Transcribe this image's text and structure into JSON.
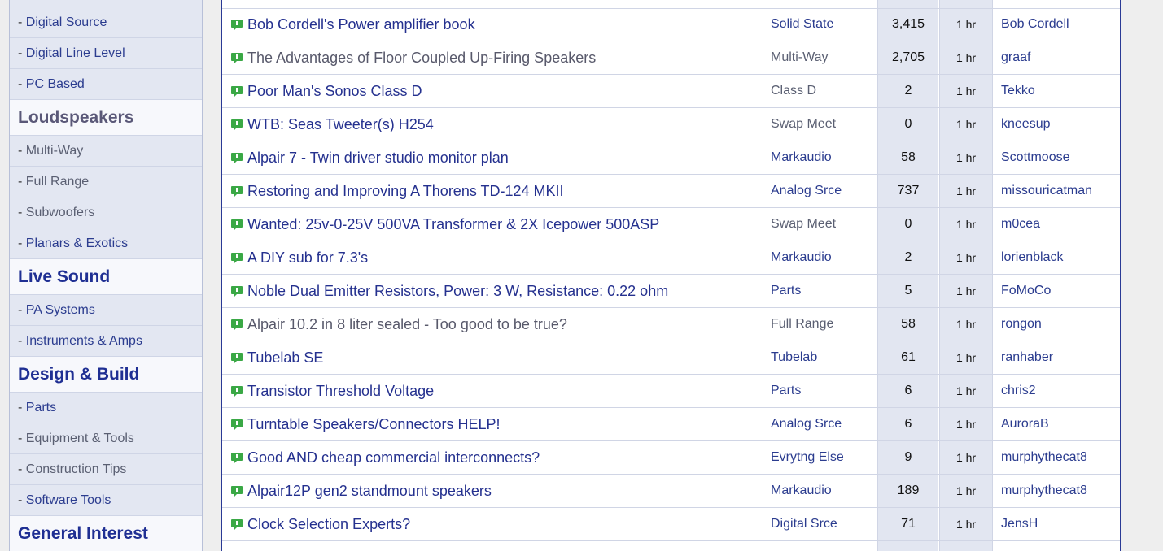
{
  "sidebar": {
    "items": [
      {
        "type": "item",
        "label": "Digital Source",
        "style": "link-blue"
      },
      {
        "type": "item",
        "label": "Digital Line Level",
        "style": "link-blue"
      },
      {
        "type": "item",
        "label": "PC Based",
        "style": "link-blue"
      },
      {
        "type": "header",
        "label": "Loudspeakers",
        "style": "visited"
      },
      {
        "type": "item",
        "label": "Multi-Way",
        "style": "link-gray"
      },
      {
        "type": "item",
        "label": "Full Range",
        "style": "link-gray"
      },
      {
        "type": "item",
        "label": "Subwoofers",
        "style": "link-gray"
      },
      {
        "type": "item",
        "label": "Planars & Exotics",
        "style": "link-blue"
      },
      {
        "type": "header",
        "label": "Live Sound",
        "style": "active"
      },
      {
        "type": "item",
        "label": "PA Systems",
        "style": "link-blue"
      },
      {
        "type": "item",
        "label": "Instruments & Amps",
        "style": "link-blue"
      },
      {
        "type": "header",
        "label": "Design & Build",
        "style": "active"
      },
      {
        "type": "item",
        "label": "Parts",
        "style": "link-blue"
      },
      {
        "type": "item",
        "label": "Equipment & Tools",
        "style": "link-gray"
      },
      {
        "type": "item",
        "label": "Construction Tips",
        "style": "link-gray"
      },
      {
        "type": "item",
        "label": "Software Tools",
        "style": "link-blue"
      },
      {
        "type": "header",
        "label": "General Interest",
        "style": "active"
      }
    ]
  },
  "threads": [
    {
      "title": "Bob Cordell's Power amplifier book",
      "title_style": "t-blue",
      "forum": "Solid State",
      "forum_style": "f-blue",
      "replies": "3,415",
      "time": "1 hr",
      "user": "Bob Cordell"
    },
    {
      "title": "The Advantages of Floor Coupled Up-Firing Speakers",
      "title_style": "t-gray",
      "forum": "Multi-Way",
      "forum_style": "f-gray",
      "replies": "2,705",
      "time": "1 hr",
      "user": "graaf"
    },
    {
      "title": "Poor Man's Sonos Class D",
      "title_style": "t-blue",
      "forum": "Class D",
      "forum_style": "f-gray",
      "replies": "2",
      "time": "1 hr",
      "user": "Tekko"
    },
    {
      "title": "WTB: Seas Tweeter(s) H254",
      "title_style": "t-blue",
      "forum": "Swap Meet",
      "forum_style": "f-gray",
      "replies": "0",
      "time": "1 hr",
      "user": "kneesup"
    },
    {
      "title": "Alpair 7 - Twin driver studio monitor plan",
      "title_style": "t-blue",
      "forum": "Markaudio",
      "forum_style": "f-blue",
      "replies": "58",
      "time": "1 hr",
      "user": "Scottmoose"
    },
    {
      "title": "Restoring and Improving A Thorens TD-124 MKII",
      "title_style": "t-blue",
      "forum": "Analog Srce",
      "forum_style": "f-blue",
      "replies": "737",
      "time": "1 hr",
      "user": "missouricatman"
    },
    {
      "title": "Wanted: 25v-0-25V 500VA Transformer & 2X Icepower 500ASP",
      "title_style": "t-blue",
      "forum": "Swap Meet",
      "forum_style": "f-gray",
      "replies": "0",
      "time": "1 hr",
      "user": "m0cea"
    },
    {
      "title": "A DIY sub for 7.3's",
      "title_style": "t-blue",
      "forum": "Markaudio",
      "forum_style": "f-blue",
      "replies": "2",
      "time": "1 hr",
      "user": "lorienblack"
    },
    {
      "title": "Noble Dual Emitter Resistors, Power: 3 W, Resistance: 0.22 ohm",
      "title_style": "t-blue",
      "forum": "Parts",
      "forum_style": "f-blue",
      "replies": "5",
      "time": "1 hr",
      "user": "FoMoCo"
    },
    {
      "title": "Alpair 10.2 in 8 liter sealed - Too good to be true?",
      "title_style": "t-gray",
      "forum": "Full Range",
      "forum_style": "f-gray",
      "replies": "58",
      "time": "1 hr",
      "user": "rongon"
    },
    {
      "title": "Tubelab SE",
      "title_style": "t-blue",
      "forum": "Tubelab",
      "forum_style": "f-blue",
      "replies": "61",
      "time": "1 hr",
      "user": "ranhaber"
    },
    {
      "title": "Transistor Threshold Voltage",
      "title_style": "t-blue",
      "forum": "Parts",
      "forum_style": "f-blue",
      "replies": "6",
      "time": "1 hr",
      "user": "chris2"
    },
    {
      "title": "Turntable Speakers/Connectors HELP!",
      "title_style": "t-blue",
      "forum": "Analog Srce",
      "forum_style": "f-blue",
      "replies": "6",
      "time": "1 hr",
      "user": "AuroraB"
    },
    {
      "title": "Good AND cheap commercial interconnects?",
      "title_style": "t-blue",
      "forum": "Evrytng Else",
      "forum_style": "f-blue",
      "replies": "9",
      "time": "1 hr",
      "user": "murphythecat8"
    },
    {
      "title": "Alpair12P gen2 standmount speakers",
      "title_style": "t-blue",
      "forum": "Markaudio",
      "forum_style": "f-blue",
      "replies": "189",
      "time": "1 hr",
      "user": "murphythecat8"
    },
    {
      "title": "Clock Selection Experts?",
      "title_style": "t-blue",
      "forum": "Digital Srce",
      "forum_style": "f-blue",
      "replies": "71",
      "time": "1 hr",
      "user": "JensH"
    }
  ],
  "icons": {
    "thread": "speech-bubble-icon"
  },
  "colors": {
    "accent": "#2a3a95",
    "icon_green": "#3aa845",
    "sidebar_bg": "#e3e7f2"
  }
}
